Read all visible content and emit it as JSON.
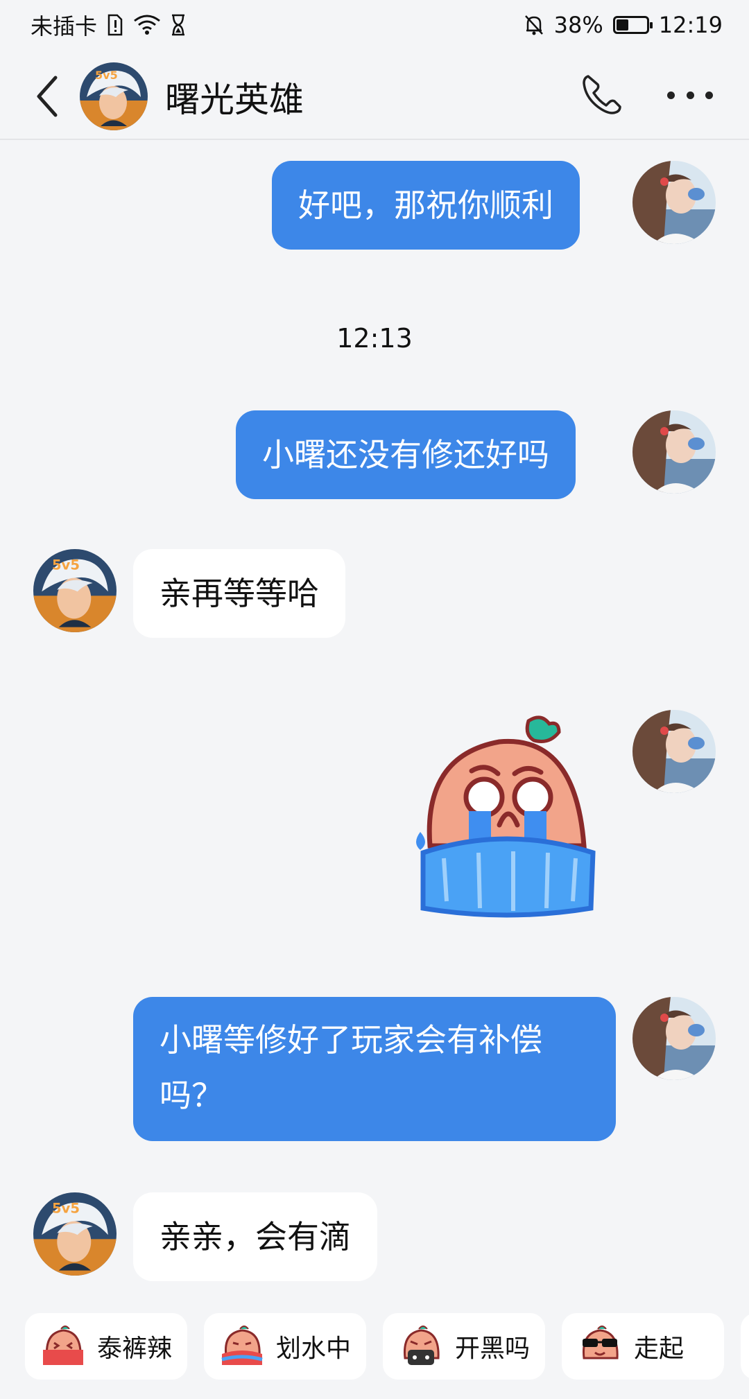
{
  "status_bar": {
    "carrier": "未插卡",
    "battery_percent": "38%",
    "battery_level": 0.38,
    "time": "12:19",
    "icons": [
      "sim-alert-icon",
      "wifi-icon",
      "hourglass-icon",
      "mute-bell-icon",
      "battery-icon"
    ]
  },
  "header": {
    "title": "曙光英雄",
    "back_icon": "back-arrow-icon",
    "call_icon": "phone-icon",
    "more_icon": "more-icon"
  },
  "messages": [
    {
      "side": "out",
      "text": "好吧，那祝你顺利"
    },
    {
      "type": "timestamp",
      "text": "12:13"
    },
    {
      "side": "out",
      "text": "小曙还没有修还好吗"
    },
    {
      "side": "in",
      "text": "亲再等等哈"
    },
    {
      "side": "out",
      "type": "sticker",
      "sticker": "crying-peach-sticker"
    },
    {
      "side": "out",
      "text": "小曙等修好了玩家会有补偿吗？"
    },
    {
      "side": "in",
      "text": "亲亲，会有滴"
    }
  ],
  "quick_replies": [
    {
      "label": "泰裤辣",
      "icon": "peach-cool-sticker-icon"
    },
    {
      "label": "划水中",
      "icon": "peach-swim-sticker-icon"
    },
    {
      "label": "开黑吗",
      "icon": "peach-game-sticker-icon"
    },
    {
      "label": "走起",
      "icon": "peach-sunglasses-sticker-icon"
    }
  ],
  "colors": {
    "background": "#f4f5f7",
    "outgoing_bubble": "#3d87e8",
    "incoming_bubble": "#ffffff"
  }
}
